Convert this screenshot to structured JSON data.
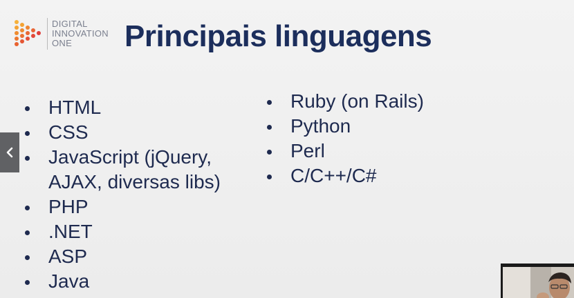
{
  "slide": {
    "logo": {
      "lines": [
        "DIGITAL",
        "INNOVATION",
        "ONE"
      ]
    },
    "title": "Principais linguagens",
    "left_list": [
      {
        "label": "HTML"
      },
      {
        "label": "CSS"
      },
      {
        "label": "JavaScript (jQuery, AJAX, diversas libs)"
      },
      {
        "label": "PHP"
      },
      {
        "label": ".NET"
      },
      {
        "label": "ASP"
      },
      {
        "label": "Java"
      }
    ],
    "right_list": [
      {
        "label": "Ruby (on Rails)"
      },
      {
        "label": "Python"
      },
      {
        "label": "Perl"
      },
      {
        "label": "C/C++/C#"
      }
    ]
  },
  "icons": {
    "nav_prev": "chevron-left-icon",
    "logo_mark": "dotted-play-logo-icon"
  },
  "colors": {
    "title": "#1c2e5c",
    "text": "#1e2a4f",
    "logo_orange": "#f0a030",
    "logo_red": "#e2463a",
    "nav_bg": "#606164"
  }
}
